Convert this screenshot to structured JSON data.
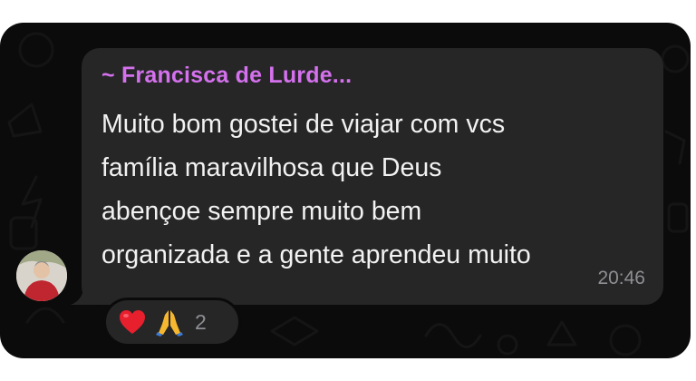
{
  "message": {
    "sender_name": "~ Francisca de Lurde...",
    "text": "Muito bom gostei de viajar com vcs\nfamília maravilhosa que Deus\nabençoe sempre muito bem\norganizada e a gente aprendeu muito",
    "time": "20:46"
  },
  "reactions": {
    "items": [
      "heart-icon",
      "praying-hands-icon"
    ],
    "count": "2"
  },
  "colors": {
    "sender": "#d571ee",
    "bubble": "#262627",
    "background": "#0b0b0b",
    "text": "#f2f2f2",
    "meta": "#8e8e93"
  }
}
